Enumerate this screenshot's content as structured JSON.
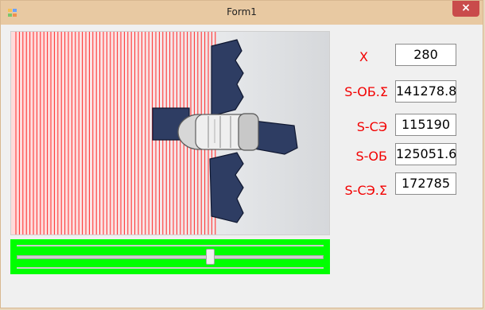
{
  "window": {
    "title": "Form1",
    "close_symbol": "×"
  },
  "slider": {
    "value_percent": 63
  },
  "readouts": [
    {
      "label": "X",
      "value": "280"
    },
    {
      "label": "S-ОБ.Σ",
      "value": "141278.8"
    },
    {
      "label": "S-СЭ",
      "value": "115190"
    },
    {
      "label": "S-ОБ",
      "value": "125051.6"
    },
    {
      "label": "S-СЭ.Σ",
      "value": "172785"
    }
  ],
  "colors": {
    "label": "#f20000",
    "slider_bg": "#00ff00",
    "scan_lines": "#ff2a2a",
    "panel_blue": "#2e3d63"
  },
  "icons": {
    "app": "window-icon",
    "close": "close-icon"
  }
}
